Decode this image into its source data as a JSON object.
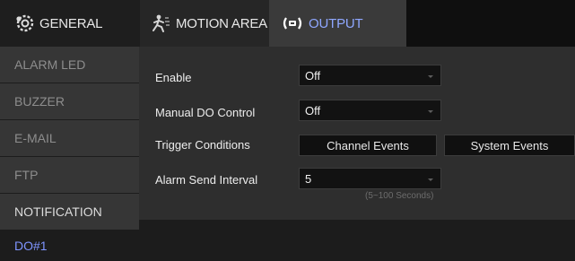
{
  "tabs": {
    "general": "GENERAL",
    "motion_area": "MOTION AREA",
    "output": "OUTPUT"
  },
  "sidebar": {
    "items": [
      "ALARM LED",
      "BUZZER",
      "E-MAIL",
      "FTP",
      "NOTIFICATION",
      "DO#1"
    ],
    "active_item": "DO#1"
  },
  "form": {
    "enable": {
      "label": "Enable",
      "value": "Off"
    },
    "manual_do": {
      "label": "Manual DO Control",
      "value": "Off"
    },
    "trigger": {
      "label": "Trigger Conditions",
      "channel_events": "Channel Events",
      "system_events": "System Events"
    },
    "alarm_interval": {
      "label": "Alarm Send Interval",
      "value": "5",
      "hint": "(5~100 Seconds)"
    }
  },
  "colors": {
    "accent": "#7f95ff",
    "panel": "#2e2e2e",
    "background": "#1c1c1c"
  },
  "icons": [
    "gear-icon",
    "motion-area-icon",
    "output-signal-icon"
  ]
}
